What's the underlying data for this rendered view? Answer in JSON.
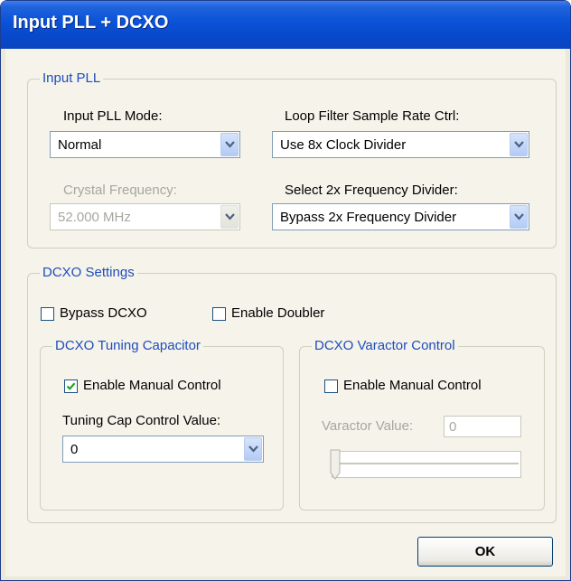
{
  "window": {
    "title": "Input PLL + DCXO"
  },
  "input_pll": {
    "group_label": "Input PLL",
    "mode_label": "Input PLL Mode:",
    "mode_value": "Normal",
    "crystal_label": "Crystal Frequency:",
    "crystal_value": "52.000 MHz",
    "loop_filter_label": "Loop Filter Sample Rate Ctrl:",
    "loop_filter_value": "Use 8x Clock Divider",
    "divider_label": "Select 2x Frequency Divider:",
    "divider_value": "Bypass 2x Frequency Divider"
  },
  "dcxo": {
    "group_label": "DCXO Settings",
    "bypass_label": "Bypass DCXO",
    "bypass_checked": false,
    "doubler_label": "Enable Doubler",
    "doubler_checked": false,
    "tuning": {
      "group_label": "DCXO Tuning Capacitor",
      "manual_label": "Enable Manual Control",
      "manual_checked": true,
      "cap_label": "Tuning Cap Control Value:",
      "cap_value": "0"
    },
    "varactor": {
      "group_label": "DCXO Varactor Control",
      "manual_label": "Enable Manual Control",
      "manual_checked": false,
      "value_label": "Varactor Value:",
      "value": "0",
      "slider_level": 0
    }
  },
  "buttons": {
    "ok_label": "OK"
  },
  "icons": {
    "combo_arrow": "chevron-down-icon",
    "check": "checkmark-icon"
  },
  "colors": {
    "title_bar": "#0a4ed4",
    "group_label": "#1f4dbd",
    "check_mark": "#21a121"
  }
}
